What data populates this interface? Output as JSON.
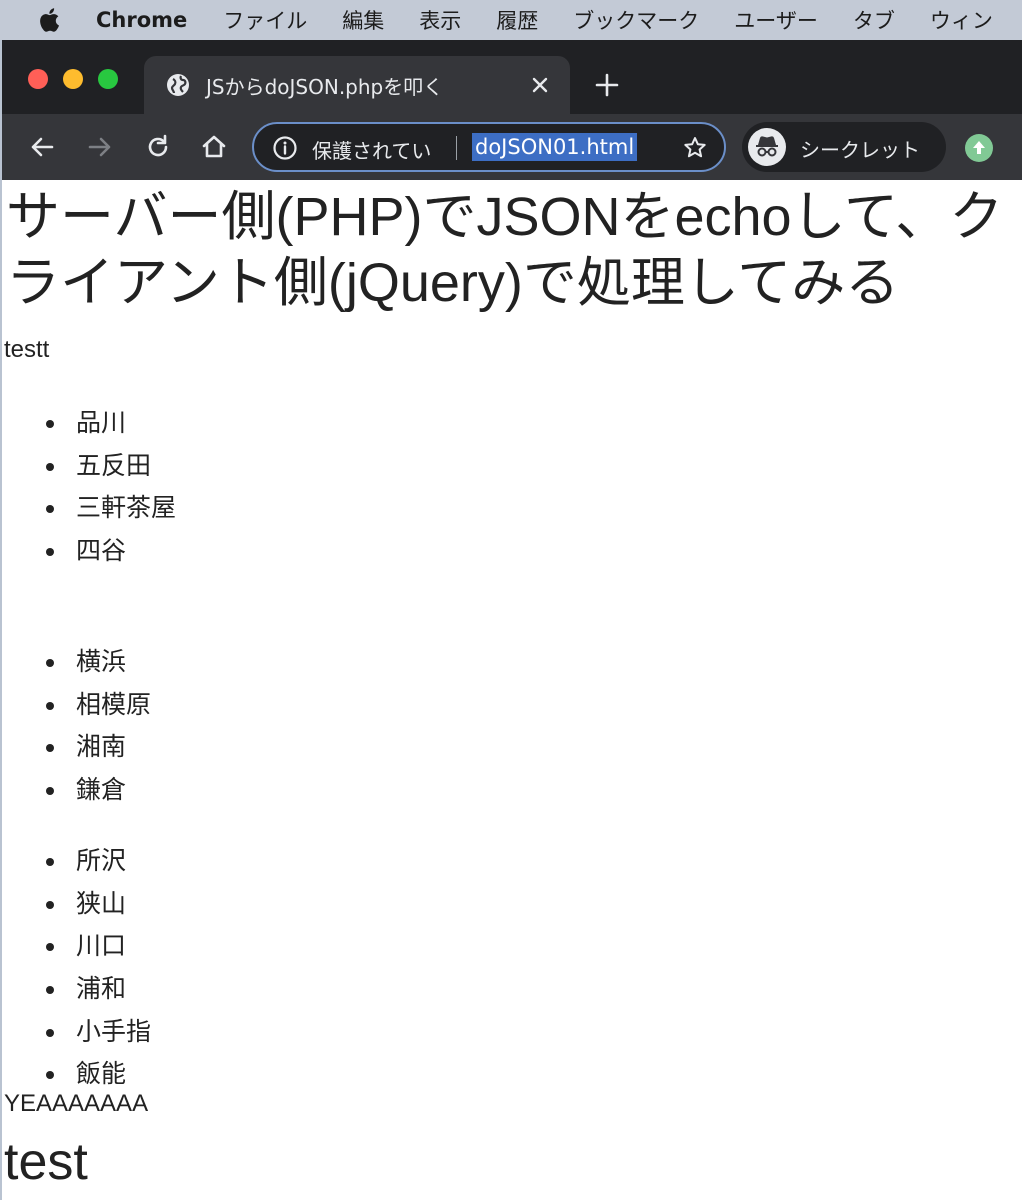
{
  "menubar": {
    "app_name": "Chrome",
    "items": [
      "ファイル",
      "編集",
      "表示",
      "履歴",
      "ブックマーク",
      "ユーザー",
      "タブ",
      "ウィン"
    ]
  },
  "browser": {
    "tab": {
      "title": "JSからdoJSON.phpを叩く"
    },
    "omnibox": {
      "security_text": "保護されてい",
      "url": "doJSON01.html"
    },
    "incognito_label": "シークレット",
    "colors": {
      "tab_strip": "#202124",
      "toolbar": "#35363a",
      "url_highlight": "#3d6ec4",
      "update_badge": "#81c995"
    }
  },
  "page": {
    "title": "サーバー側(PHP)でJSONをechoして、クライアント側(jQuery)で処理してみる",
    "intro_text": "testt",
    "lists": [
      [
        "品川",
        "五反田",
        "三軒茶屋",
        "四谷"
      ],
      [
        "横浜",
        "相模原",
        "湘南",
        "鎌倉"
      ],
      [
        "所沢",
        "狭山",
        "川口",
        "浦和",
        "小手指",
        "飯能"
      ]
    ],
    "footer_text": "YEAAAAAAA",
    "footer_heading": "test"
  }
}
